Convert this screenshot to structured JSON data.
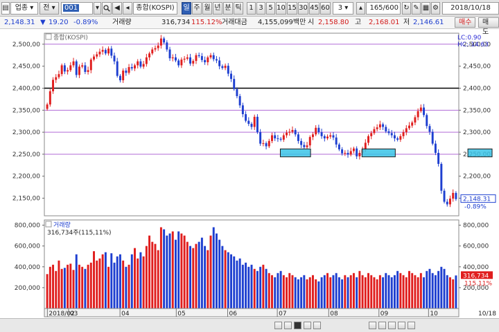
{
  "toolbar": {
    "market": "업종",
    "jeon": "전",
    "code": "001",
    "name": "종합(KOSPI)",
    "periods": [
      "일",
      "주",
      "월",
      "년",
      "분",
      "틱"
    ],
    "minutes": [
      "1",
      "3",
      "5",
      "10",
      "15",
      "30",
      "45",
      "60"
    ],
    "interval": "3",
    "count": "165/600",
    "date": "2018/10/18"
  },
  "quote": {
    "price": "2,148.31",
    "change": "19.20",
    "change_pct": "-0.89%",
    "volume_label": "거래량",
    "volume": "316,734",
    "volume_ratio": "115.12%",
    "amount_label": "거래대금",
    "amount": "4,155,099백만",
    "open_label": "시",
    "open": "2,158.80",
    "high_label": "고",
    "high": "2,168.01",
    "low_label": "저",
    "low": "2,146.61",
    "buy": "매수",
    "sell": "매도"
  },
  "chart_data": {
    "type": "candlestick",
    "title": "종합(KOSPI)",
    "indicator_lc": "LC:0.90",
    "indicator_hc": "HC:-14.63",
    "price_axis": {
      "ticks": [
        2500,
        2450,
        2400,
        2350,
        2300,
        2250,
        2200,
        2150
      ],
      "tick_labels": [
        "2,500,00",
        "2,450,00",
        "2,400,00",
        "2,350,00",
        "2,300,00",
        "2,250,00",
        "2,200,00",
        "2,150,00"
      ],
      "ylim": [
        2110,
        2525
      ]
    },
    "reference_lines": [
      {
        "value": 2500,
        "color": "#b06ad6"
      },
      {
        "value": 2400,
        "color": "#000000"
      },
      {
        "value": 2350,
        "color": "#b06ad6"
      },
      {
        "value": 2300,
        "color": "#b06ad6"
      },
      {
        "value": 2250,
        "color": "#b06ad6"
      }
    ],
    "support_boxes": [
      {
        "start": 2018.505,
        "end": 2018.555,
        "low": 2244,
        "high": 2262
      },
      {
        "start": 2018.64,
        "end": 2018.695,
        "low": 2244,
        "high": 2262
      },
      {
        "start": 2018.815,
        "end": 2018.855,
        "low": 2244,
        "high": 2262
      }
    ],
    "last_price_label": "2,148.31",
    "last_change_label": "-0.89%",
    "last_price": 2148.31,
    "x_start": 2018.115,
    "x_end": 2018.8,
    "months": [
      {
        "label": "2018/02",
        "pos": 2018.12
      },
      {
        "label": "03",
        "pos": 2018.155
      },
      {
        "label": "04",
        "pos": 2018.24
      },
      {
        "label": "05",
        "pos": 2018.333
      },
      {
        "label": "06",
        "pos": 2018.418
      },
      {
        "label": "07",
        "pos": 2018.5
      },
      {
        "label": "08",
        "pos": 2018.585
      },
      {
        "label": "09",
        "pos": 2018.668
      },
      {
        "label": "10",
        "pos": 2018.75
      }
    ],
    "month_positions": [
      0.0,
      0.07,
      0.23,
      0.38,
      0.52,
      0.67,
      0.82,
      0.97,
      1.12
    ],
    "x_right_label": "10/18",
    "volume_title": "거래량",
    "volume_subtitle": "316,734주(115,11%)",
    "volume_axis": {
      "ticks": [
        800000,
        600000,
        400000,
        200000
      ],
      "tick_labels": [
        "800,000",
        "600,000",
        "400,000",
        "200,000"
      ],
      "ylim": [
        0,
        850000
      ]
    },
    "last_volume_label": "316,734",
    "last_volume_pct_label": "115.11%",
    "closes": [
      2363,
      2393,
      2419,
      2425,
      2432,
      2452,
      2438,
      2441,
      2452,
      2461,
      2430,
      2449,
      2452,
      2437,
      2441,
      2465,
      2472,
      2477,
      2483,
      2487,
      2479,
      2490,
      2474,
      2461,
      2428,
      2418,
      2440,
      2435,
      2448,
      2445,
      2452,
      2461,
      2449,
      2455,
      2470,
      2479,
      2488,
      2491,
      2497,
      2513,
      2504,
      2488,
      2468,
      2470,
      2463,
      2452,
      2465,
      2467,
      2470,
      2456,
      2462,
      2475,
      2473,
      2464,
      2459,
      2470,
      2475,
      2466,
      2463,
      2450,
      2446,
      2451,
      2433,
      2421,
      2398,
      2382,
      2361,
      2341,
      2326,
      2319,
      2312,
      2335,
      2300,
      2274,
      2275,
      2268,
      2280,
      2293,
      2286,
      2285,
      2283,
      2293,
      2299,
      2301,
      2305,
      2295,
      2280,
      2271,
      2266,
      2270,
      2289,
      2295,
      2310,
      2300,
      2291,
      2286,
      2290,
      2293,
      2288,
      2272,
      2261,
      2252,
      2253,
      2249,
      2257,
      2263,
      2245,
      2253,
      2260,
      2276,
      2291,
      2298,
      2307,
      2311,
      2318,
      2312,
      2302,
      2298,
      2293,
      2286,
      2283,
      2291,
      2300,
      2309,
      2315,
      2322,
      2334,
      2348,
      2356,
      2339,
      2314,
      2301,
      2274,
      2253,
      2228,
      2167,
      2142,
      2136,
      2149,
      2162,
      2148
    ],
    "volumes": [
      330,
      400,
      420,
      360,
      460,
      380,
      390,
      420,
      430,
      370,
      520,
      420,
      400,
      380,
      420,
      440,
      550,
      460,
      480,
      520,
      540,
      400,
      530,
      440,
      500,
      520,
      460,
      400,
      420,
      520,
      580,
      480,
      540,
      500,
      600,
      700,
      640,
      620,
      560,
      780,
      760,
      700,
      720,
      740,
      660,
      740,
      720,
      700,
      640,
      600,
      580,
      620,
      640,
      680,
      600,
      560,
      700,
      780,
      720,
      660,
      600,
      560,
      540,
      520,
      500,
      460,
      480,
      420,
      440,
      400,
      420,
      380,
      360,
      400,
      420,
      380,
      340,
      320,
      300,
      340,
      360,
      320,
      300,
      340,
      320,
      300,
      280,
      300,
      320,
      280,
      300,
      320,
      280,
      260,
      300,
      320,
      340,
      300,
      320,
      340,
      300,
      280,
      320,
      300,
      320,
      340,
      300,
      360,
      320,
      300,
      340,
      320,
      300,
      280,
      320,
      300,
      340,
      320,
      300,
      320,
      360,
      340,
      320,
      300,
      360,
      340,
      320,
      300,
      340,
      300,
      360,
      380,
      340,
      320,
      360,
      400,
      380,
      320,
      300,
      280,
      317
    ]
  },
  "bottom": {
    "icons": [
      "prev-button",
      "next-button",
      "stop-button",
      "play-button",
      "step-button"
    ]
  }
}
